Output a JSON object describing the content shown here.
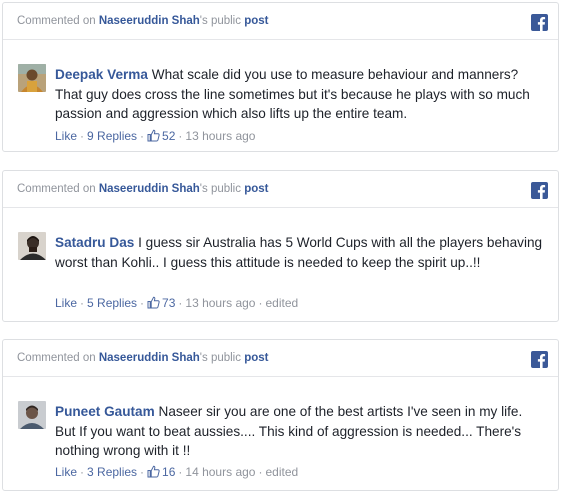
{
  "comments": [
    {
      "header": {
        "prefix": "Commented on",
        "page_name": "Naseeruddin Shah",
        "middle": "'s public",
        "post_link": "post"
      },
      "author": "Deepak Verma",
      "text": "What scale did you use to measure behaviour and manners? That guy does cross the line sometimes but it's because he plays with so much passion and aggression which also lifts up the entire team.",
      "like_label": "Like",
      "replies_label": "9 Replies",
      "likes_count": "52",
      "time": "13 hours ago",
      "edited": ""
    },
    {
      "header": {
        "prefix": "Commented on",
        "page_name": "Naseeruddin Shah",
        "middle": "'s public",
        "post_link": "post"
      },
      "author": "Satadru Das",
      "text": "I guess sir Australia has 5 World Cups with all the players behaving worst than Kohli.. I guess this attitude is needed to keep the spirit up..!!",
      "like_label": "Like",
      "replies_label": "5 Replies",
      "likes_count": "73",
      "time": "13 hours ago",
      "edited": "edited"
    },
    {
      "header": {
        "prefix": "Commented on",
        "page_name": "Naseeruddin Shah",
        "middle": "'s public",
        "post_link": "post"
      },
      "author": "Puneet Gautam",
      "text": "Naseer sir you are one of the best artists I've seen in my life. But If you want to beat aussies.... This kind of aggression is needed... There's nothing wrong with it !!",
      "like_label": "Like",
      "replies_label": "3 Replies",
      "likes_count": "16",
      "time": "14 hours ago",
      "edited": "edited"
    }
  ],
  "icons": {
    "brand": "facebook-icon",
    "reaction": "thumbs-up-icon"
  },
  "colors": {
    "link": "#365899",
    "muted": "#90949c",
    "facebook": "#3b5998"
  }
}
